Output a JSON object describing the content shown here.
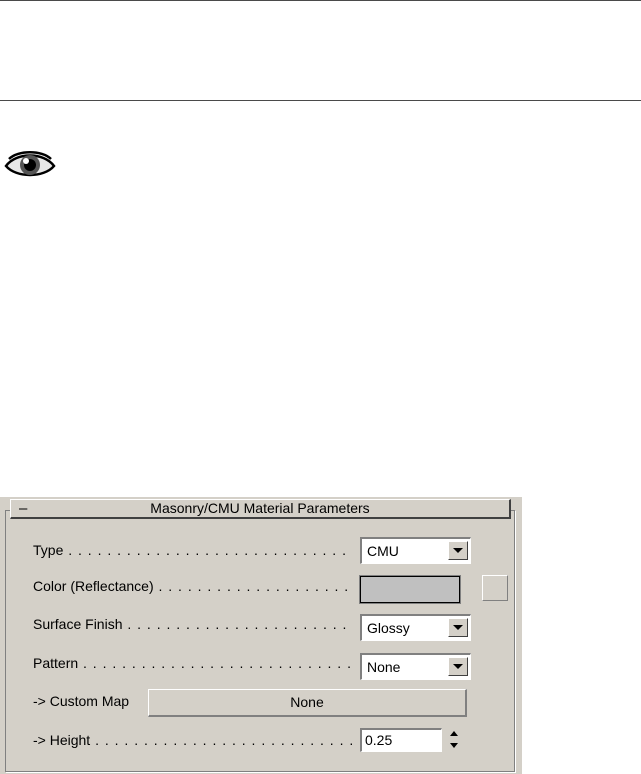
{
  "rollout": {
    "collapse_symbol": "–",
    "title": "Masonry/CMU Material Parameters"
  },
  "fields": {
    "type": {
      "label": "Type",
      "dots": " . . . . . . . . . . . . . . . . . . . . . . . . . . . . . . . . . . . .",
      "value": "CMU"
    },
    "color": {
      "label": "Color (Reflectance)",
      "dots": " . . . . . . . . . . . . . . . . . . . . . . . . . . . .",
      "swatch_color": "#c0c0c0"
    },
    "surface_finish": {
      "label": "Surface Finish",
      "dots": " . . . . . . . . . . . . . . . . . . . . . . . . . . . . . .",
      "value": "Glossy"
    },
    "pattern": {
      "label": "Pattern",
      "dots": " . . . . . . . . . . . . . . . . . . . . . . . . . . . . . . . . . .",
      "value": "None"
    },
    "custom_map": {
      "label": "-> Custom Map",
      "button_label": "None"
    },
    "height": {
      "label": "-> Height",
      "dots": " . . . . . . . . . . . . . . . . . . . . . . . . . . . . . . .",
      "value": "0.25"
    }
  },
  "icons": {
    "eye": "eye-icon"
  },
  "colors": {
    "panel_background": "#d4d0c8",
    "page_background": "#ffffff"
  }
}
